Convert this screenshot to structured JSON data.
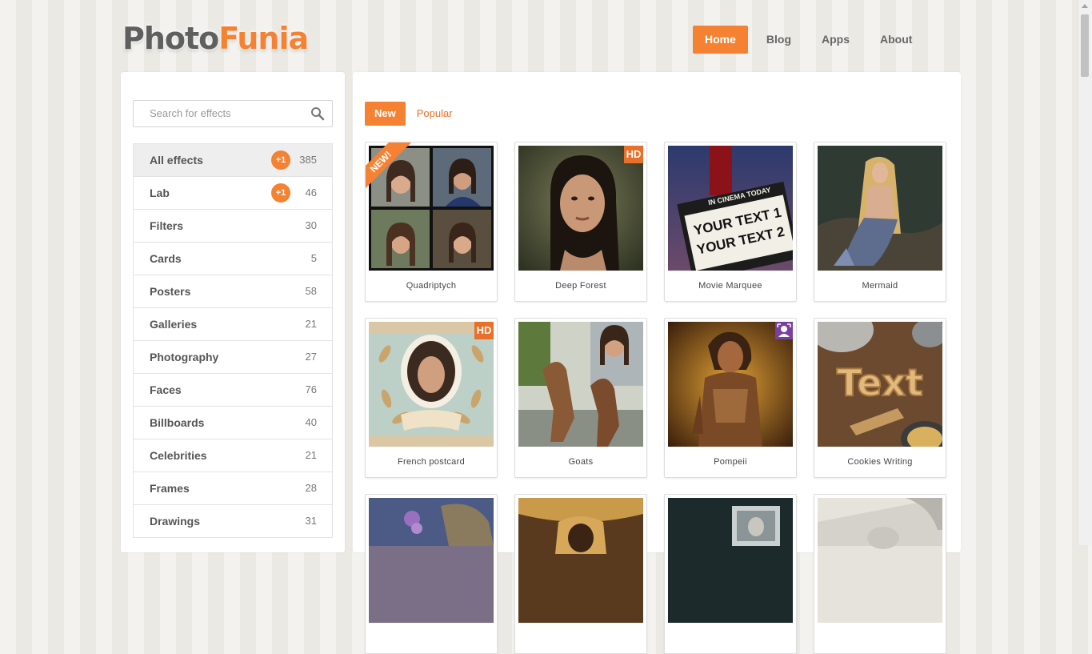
{
  "logo": {
    "part1": "Photo",
    "part2": "Funia"
  },
  "nav": [
    {
      "label": "Home",
      "active": true
    },
    {
      "label": "Blog",
      "active": false
    },
    {
      "label": "Apps",
      "active": false
    },
    {
      "label": "About",
      "active": false
    }
  ],
  "search": {
    "placeholder": "Search for effects",
    "icon": "search-icon"
  },
  "categories": [
    {
      "label": "All effects",
      "count": "385",
      "badge": "+1"
    },
    {
      "label": "Lab",
      "count": "46",
      "badge": "+1"
    },
    {
      "label": "Filters",
      "count": "30"
    },
    {
      "label": "Cards",
      "count": "5"
    },
    {
      "label": "Posters",
      "count": "58"
    },
    {
      "label": "Galleries",
      "count": "21"
    },
    {
      "label": "Photography",
      "count": "27"
    },
    {
      "label": "Faces",
      "count": "76"
    },
    {
      "label": "Billboards",
      "count": "40"
    },
    {
      "label": "Celebrities",
      "count": "21"
    },
    {
      "label": "Frames",
      "count": "28"
    },
    {
      "label": "Drawings",
      "count": "31"
    }
  ],
  "tabs": [
    {
      "label": "New",
      "active": true
    },
    {
      "label": "Popular",
      "active": false
    }
  ],
  "effects": [
    {
      "title": "Quadriptych",
      "ribbon": "NEW!"
    },
    {
      "title": "Deep Forest",
      "hd": "HD"
    },
    {
      "title": "Movie Marquee",
      "marquee_top": "IN CINEMA TODAY",
      "marquee_line1": "YOUR TEXT 1",
      "marquee_line2": "YOUR TEXT 2"
    },
    {
      "title": "Mermaid"
    },
    {
      "title": "French postcard",
      "hd": "HD"
    },
    {
      "title": "Goats"
    },
    {
      "title": "Pompeii",
      "icon": "face-detect-icon"
    },
    {
      "title": "Cookies Writing",
      "cookie_text": "Text"
    },
    {
      "title": ""
    },
    {
      "title": ""
    },
    {
      "title": ""
    },
    {
      "title": ""
    }
  ],
  "colors": {
    "accent": "#f58233",
    "text": "#555555"
  }
}
